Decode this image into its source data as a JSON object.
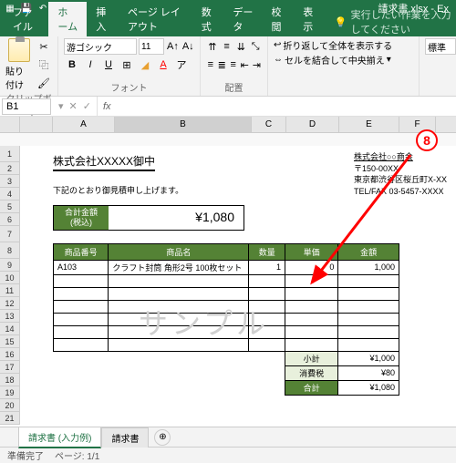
{
  "titlebar": {
    "filename": "請求書.xlsx - Ex"
  },
  "tabs": {
    "file": "ファイル",
    "home": "ホーム",
    "insert": "挿入",
    "pagelayout": "ページ レイアウト",
    "formulas": "数式",
    "data": "データ",
    "review": "校閲",
    "view": "表示",
    "tellme": "実行したい作業を入力してください"
  },
  "ribbon": {
    "paste": "貼り付け",
    "clipboard_label": "クリップボード",
    "font_label": "フォント",
    "align_label": "配置",
    "font_name": "游ゴシック",
    "font_size": "11",
    "wrap": "折り返して全体を表示する",
    "merge": "セルを結合して中央揃え",
    "numfmt": "標準"
  },
  "namebox": {
    "ref": "B1"
  },
  "cols": [
    "A",
    "B",
    "C",
    "D",
    "E",
    "F"
  ],
  "rows": [
    "1",
    "2",
    "3",
    "4",
    "5",
    "6",
    "7",
    "8",
    "9",
    "10",
    "11",
    "12",
    "13",
    "14",
    "15",
    "16",
    "17",
    "18",
    "19",
    "20",
    "21"
  ],
  "doc": {
    "title": "株式会社XXXXX御中",
    "company": "株式会社○○商会",
    "postal": "〒150-00XX",
    "addr": "東京都渋谷区桜丘町X-XX",
    "tel": "TEL/FAX 03-5457-XXXX",
    "intro": "下記のとおり御見積申し上げます。",
    "total_label1": "合計金額",
    "total_label2": "(税込)",
    "total_value": "¥1,080",
    "watermark": "サンプル"
  },
  "table": {
    "headers": {
      "code": "商品番号",
      "name": "商品名",
      "qty": "数量",
      "price": "単価",
      "amount": "金額"
    },
    "rows": [
      {
        "code": "A103",
        "name": "クラフト封筒 角形2号 100枚セット",
        "qty": "1",
        "price": "0",
        "amount": "1,000"
      }
    ],
    "subtotal_label": "小計",
    "subtotal": "¥1,000",
    "tax_label": "消費税",
    "tax": "¥80",
    "grand_label": "合計",
    "grand": "¥1,080"
  },
  "callout": {
    "num": "8"
  },
  "sheets": {
    "active": "請求書 (入力例)",
    "other": "請求書"
  },
  "status": {
    "ready": "準備完了",
    "page": "ページ: 1/1"
  }
}
